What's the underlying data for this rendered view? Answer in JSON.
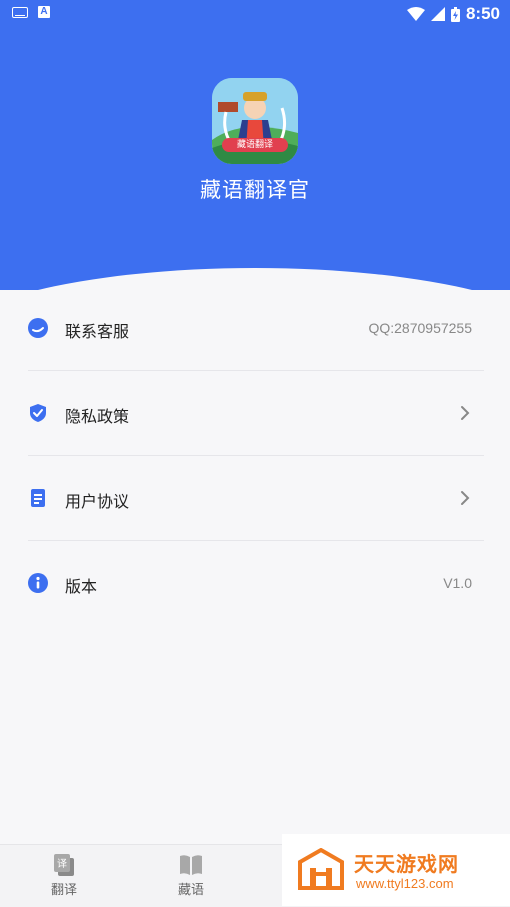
{
  "status_bar": {
    "time": "8:50"
  },
  "app": {
    "title": "藏语翻译官",
    "logo_badge": "藏语翻译"
  },
  "menu": [
    {
      "label": "联系客服",
      "value": "QQ:2870957255",
      "icon": "chat-icon"
    },
    {
      "label": "隐私政策",
      "icon": "shield-icon",
      "chevron": true
    },
    {
      "label": "用户协议",
      "icon": "document-icon",
      "chevron": true
    },
    {
      "label": "版本",
      "value": "V1.0",
      "icon": "info-icon"
    }
  ],
  "bottom_nav": [
    {
      "label": "翻译",
      "icon": "translate-icon"
    },
    {
      "label": "藏语",
      "icon": "book-icon"
    }
  ],
  "watermark": {
    "line1": "天天游戏网",
    "line2": "www.ttyl123.com"
  },
  "colors": {
    "accent": "#3d6ff0",
    "background": "#f7f7f9",
    "watermark": "#f07b20"
  }
}
